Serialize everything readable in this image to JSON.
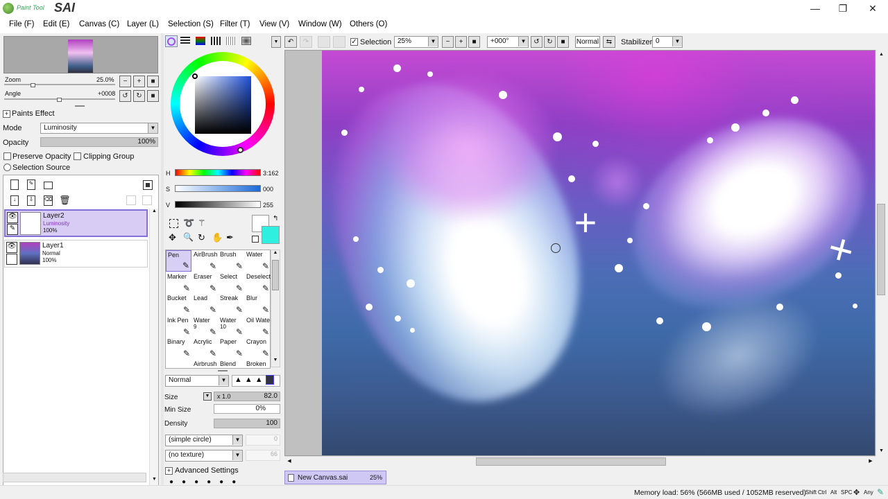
{
  "app": {
    "logo_small": "Paint Tool",
    "logo_big": "SAI"
  },
  "window_controls": {
    "minimize": "—",
    "maximize": "❐",
    "close": "✕"
  },
  "menu": [
    "File (F)",
    "Edit (E)",
    "Canvas (C)",
    "Layer (L)",
    "Selection (S)",
    "Filter (T)",
    "View (V)",
    "Window (W)",
    "Others (O)"
  ],
  "navigator": {
    "zoom_label": "Zoom",
    "zoom_value": "25.0%",
    "angle_label": "Angle",
    "angle_value": "+0008"
  },
  "layer_panel": {
    "paints_effect": "Paints Effect",
    "mode_label": "Mode",
    "mode_value": "Luminosity",
    "opacity_label": "Opacity",
    "opacity_value": "100%",
    "preserve_opacity": "Preserve Opacity",
    "clipping_group": "Clipping Group",
    "selection_source": "Selection Source",
    "layers": [
      {
        "name": "Layer2",
        "mode": "Luminosity",
        "opacity": "100%",
        "selected": true
      },
      {
        "name": "Layer1",
        "mode": "Normal",
        "opacity": "100%",
        "selected": false
      }
    ]
  },
  "color": {
    "h_label": "H",
    "h_value": "3:162",
    "s_label": "S",
    "s_value": "000",
    "v_label": "V",
    "v_value": "255",
    "primary": "#ffffff",
    "secondary": "#2ff0e0"
  },
  "tools": [
    {
      "name": "Pen",
      "icon": "pen-icon"
    },
    {
      "name": "AirBrush",
      "icon": "airbrush-icon"
    },
    {
      "name": "Brush",
      "icon": "brush-icon"
    },
    {
      "name": "Water",
      "icon": "water-icon"
    },
    {
      "name": "Marker",
      "icon": "marker-icon"
    },
    {
      "name": "Eraser",
      "icon": "eraser-icon"
    },
    {
      "name": "Select",
      "icon": "select-icon"
    },
    {
      "name": "Deselect",
      "icon": "deselect-icon"
    },
    {
      "name": "Bucket",
      "icon": "bucket-icon"
    },
    {
      "name": "Lead",
      "icon": "lead-icon"
    },
    {
      "name": "Streak",
      "icon": "streak-icon"
    },
    {
      "name": "Blur",
      "icon": "blur-icon"
    },
    {
      "name": "Ink Pen",
      "icon": "ink-pen-icon"
    },
    {
      "name": "Water",
      "sub": "9",
      "icon": "water-icon"
    },
    {
      "name": "Water",
      "sub": "10",
      "icon": "water-icon"
    },
    {
      "name": "Oil Wate",
      "icon": "oil-water-icon"
    },
    {
      "name": "Binary",
      "icon": "binary-icon"
    },
    {
      "name": "Acrylic",
      "icon": "acrylic-icon"
    },
    {
      "name": "Paper",
      "icon": "paper-icon"
    },
    {
      "name": "Crayon",
      "icon": "crayon-icon"
    },
    {
      "name": "",
      "icon": ""
    },
    {
      "name": "Airbrush",
      "icon": ""
    },
    {
      "name": "Blend",
      "icon": ""
    },
    {
      "name": "Broken",
      "icon": ""
    }
  ],
  "brush": {
    "blend_mode": "Normal",
    "size_label": "Size",
    "size_mult": "x 1.0",
    "size_value": "82.0",
    "min_size_label": "Min Size",
    "min_size_value": "0%",
    "density_label": "Density",
    "density_value": "100",
    "shape": "(simple circle)",
    "shape_value": "0",
    "texture": "(no texture)",
    "texture_value": "66",
    "advanced": "Advanced Settings"
  },
  "toolbar": {
    "selection_label": "Selection",
    "zoom_value": "25%",
    "angle_value": "+000°",
    "blend_value": "Normal",
    "stabilizer_label": "Stabilizer",
    "stabilizer_value": "0"
  },
  "tabs": [
    {
      "name": "New Canvas.sai",
      "zoom": "25%"
    }
  ],
  "status": {
    "memory": "Memory load: 56% (566MB used / 1052MB reserved)",
    "keys": [
      "Shift",
      "Ctrl",
      "Alt",
      "SPC",
      "Any"
    ]
  }
}
